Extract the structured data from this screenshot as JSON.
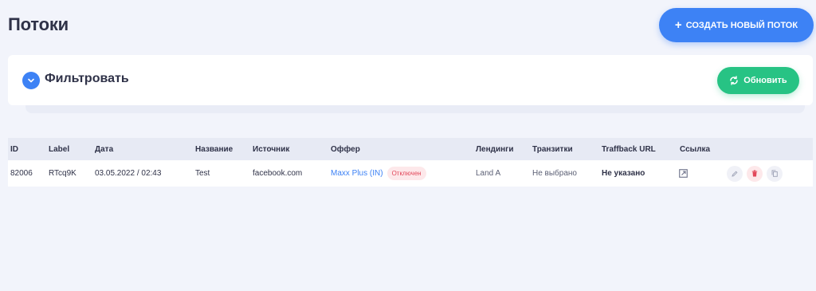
{
  "page": {
    "title": "Потоки"
  },
  "header": {
    "create_label": "СОЗДАТЬ НОВЫЙ ПОТОК",
    "create_icon": "plus-icon"
  },
  "filter": {
    "title": "Фильтровать",
    "refresh_label": "Обновить"
  },
  "table": {
    "columns": [
      "ID",
      "Label",
      "Дата",
      "Название",
      "Источник",
      "Оффер",
      "Лендинги",
      "Транзитки",
      "Traffback URL",
      "Ссылка"
    ],
    "rows": [
      {
        "id": "82006",
        "label": "RTcq9K",
        "date": "03.05.2022 / 02:43",
        "name": "Test",
        "source": "facebook.com",
        "offer": "Maxx Plus (IN)",
        "offer_status": "Отключен",
        "landing": "Land A",
        "transit": "Не выбрано",
        "traffback": "Не указано"
      }
    ]
  },
  "colors": {
    "accent": "#3d82f5",
    "success": "#27c384",
    "danger": "#e2475a",
    "background": "#f2f4fb"
  }
}
